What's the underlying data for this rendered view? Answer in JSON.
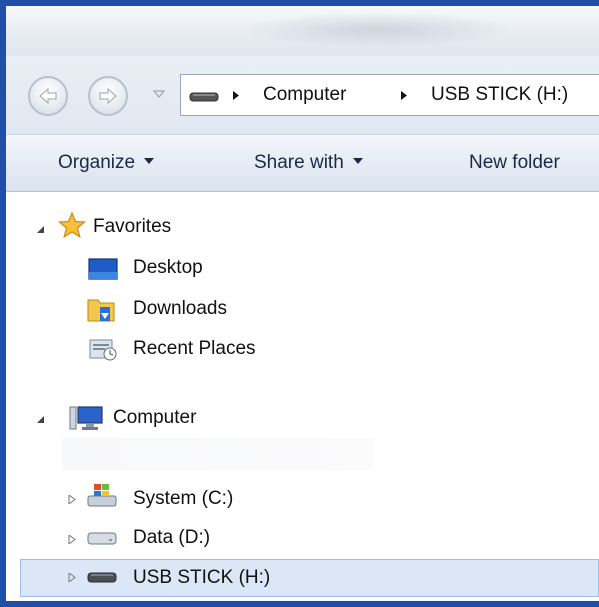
{
  "address_bar": {
    "breadcrumbs": [
      "Computer",
      "USB STICK (H:)"
    ]
  },
  "toolbar": {
    "organize_label": "Organize",
    "share_label": "Share with",
    "newfolder_label": "New folder"
  },
  "nav_pane": {
    "favorites_label": "Favorites",
    "favorites_items": [
      "Desktop",
      "Downloads",
      "Recent Places"
    ],
    "computer_label": "Computer",
    "drives": [
      "System (C:)",
      "Data (D:)",
      "USB STICK (H:)"
    ]
  },
  "colors": {
    "window_border": "#1f4fa8",
    "selection": "#dbe7f6",
    "toolbar_text": "#1b2a44"
  }
}
